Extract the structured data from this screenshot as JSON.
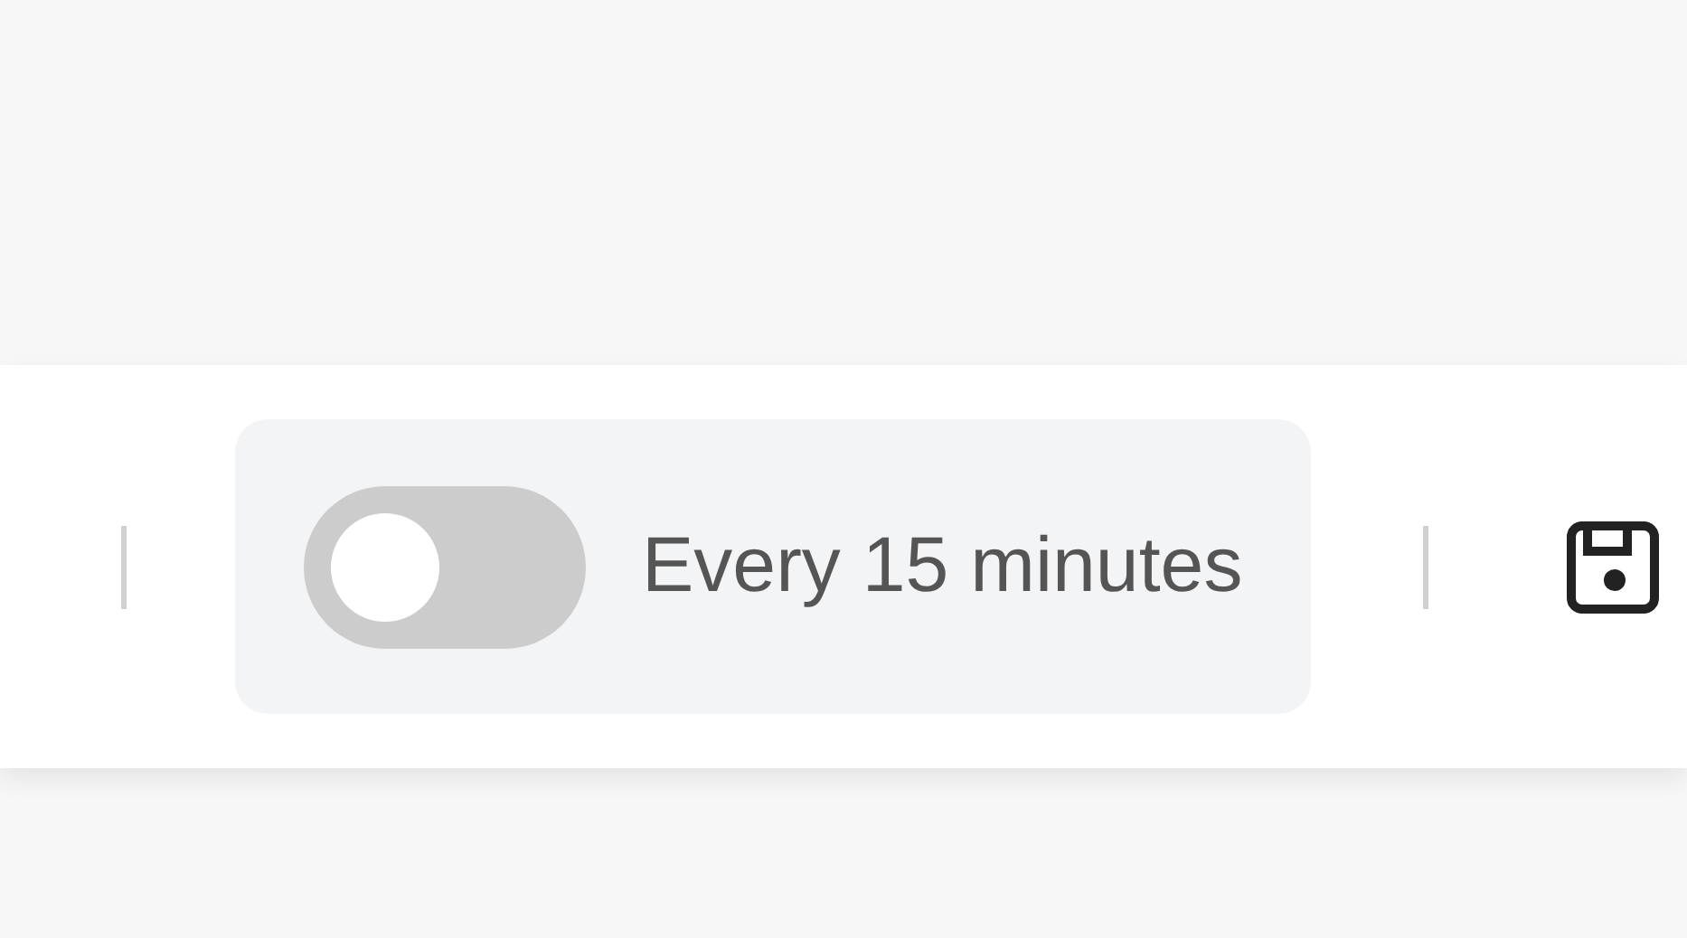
{
  "schedule_toggle": {
    "on": false,
    "label": "Every 15 minutes"
  }
}
